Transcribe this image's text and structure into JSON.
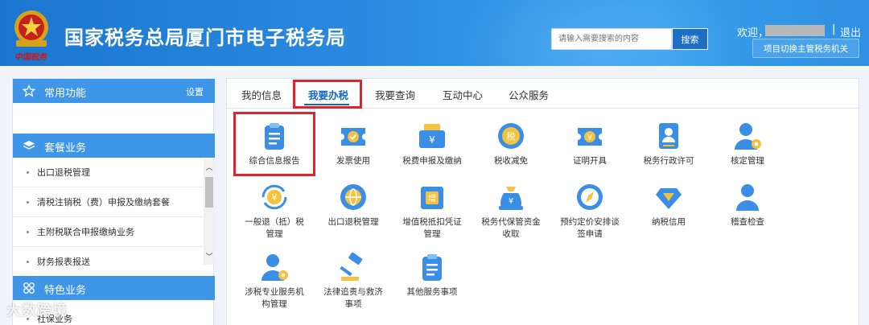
{
  "header": {
    "title": "国家税务总局厦门市电子税务局",
    "emblem_script": "中国税务",
    "search_placeholder": "请输入需要搜索的内容",
    "search_button": "搜索",
    "welcome": "欢迎，",
    "separator": "|",
    "logout": "退出",
    "switch_button": "项目切换主管税务机关"
  },
  "sidebar": {
    "common": {
      "label": "常用功能",
      "setting": "设置",
      "icon": "star-icon"
    },
    "package": {
      "label": "套餐业务",
      "icon": "layers-icon"
    },
    "package_items": [
      "出口退税管理",
      "清税注销税（费）申报及缴纳套餐",
      "主附税联合申报缴纳业务",
      "财务报表报送"
    ],
    "special": {
      "label": "特色业务",
      "icon": "grid-icon"
    },
    "special_items": [
      "社保业务"
    ],
    "scroll_up": "︿",
    "scroll_down": "﹀"
  },
  "tabs": [
    {
      "label": "我的信息",
      "active": false
    },
    {
      "label": "我要办税",
      "active": true
    },
    {
      "label": "我要查询",
      "active": false
    },
    {
      "label": "互动中心",
      "active": false
    },
    {
      "label": "公众服务",
      "active": false
    }
  ],
  "tiles_row1": [
    {
      "label": "综合信息报告",
      "icon": "clipboard-icon"
    },
    {
      "label": "发票使用",
      "icon": "ticket-icon"
    },
    {
      "label": "税费申报及缴纳",
      "icon": "wallet-icon"
    },
    {
      "label": "税收减免",
      "icon": "coin-icon"
    },
    {
      "label": "证明开具",
      "icon": "certificate-icon"
    },
    {
      "label": "税务行政许可",
      "icon": "id-card-icon"
    },
    {
      "label": "核定管理",
      "icon": "user-gear-icon"
    }
  ],
  "tiles_row2": [
    {
      "label": "一般退（抵）税",
      "label2": "管理",
      "icon": "refund-icon"
    },
    {
      "label": "出口退税管理",
      "icon": "globe-icon"
    },
    {
      "label": "增值税抵扣凭证",
      "label2": "管理",
      "icon": "vat-icon"
    },
    {
      "label": "税务代保管资金",
      "label2": "收取",
      "icon": "money-bag-icon"
    },
    {
      "label": "预约定价安排谈",
      "label2": "签申请",
      "icon": "compass-icon"
    },
    {
      "label": "纳税信用",
      "icon": "diamond-icon"
    },
    {
      "label": "稽查检查",
      "icon": "inspector-icon"
    }
  ],
  "tiles_row3": [
    {
      "label": "涉税专业服务机",
      "label2": "构管理",
      "icon": "agent-gear-icon"
    },
    {
      "label": "法律追责与救济",
      "label2": "事项",
      "icon": "gavel-icon"
    },
    {
      "label": "其他服务事项",
      "icon": "list-icon"
    }
  ],
  "watermark": "大数跨境",
  "colors": {
    "header": "#2b8ce0",
    "sidebar_head": "#3f95e8",
    "accent": "#1667c4",
    "highlight": "#e0242f"
  }
}
